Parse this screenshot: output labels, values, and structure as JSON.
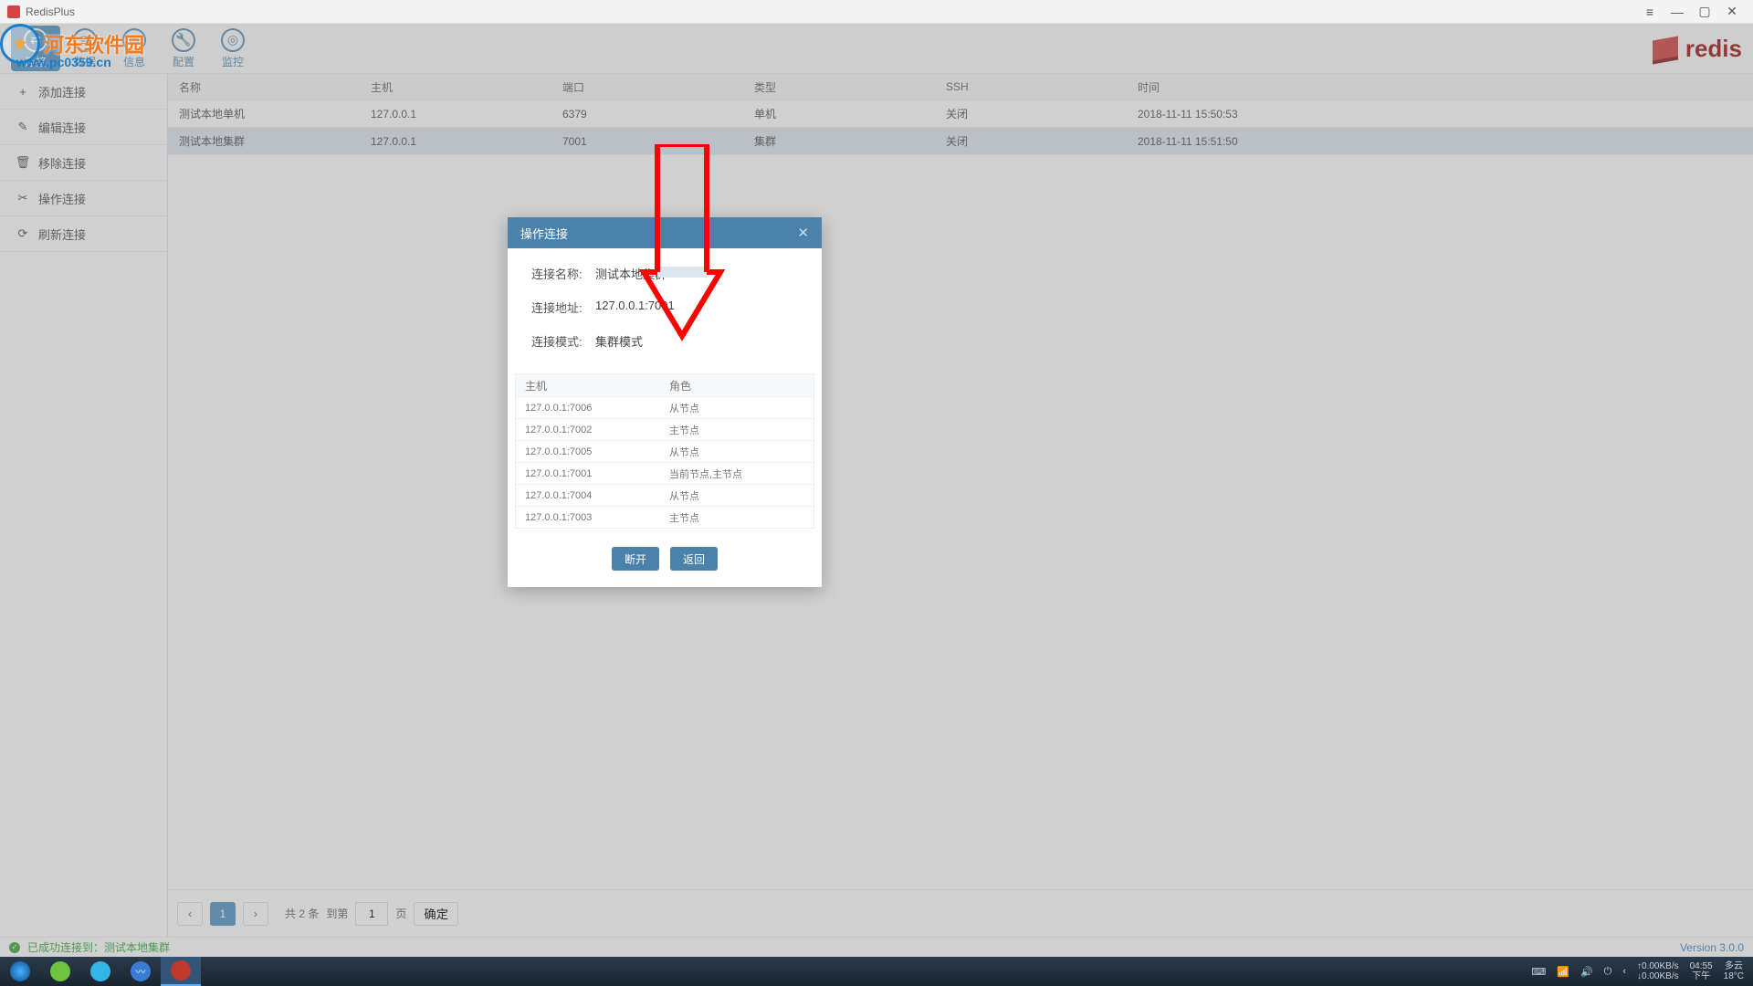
{
  "window": {
    "title": "RedisPlus"
  },
  "toolbar": {
    "items": [
      {
        "label": "连接"
      },
      {
        "label": "数据"
      },
      {
        "label": "信息"
      },
      {
        "label": "配置"
      },
      {
        "label": "监控"
      }
    ],
    "brand": "redis"
  },
  "sidebar": {
    "items": [
      {
        "label": "添加连接"
      },
      {
        "label": "编辑连接"
      },
      {
        "label": "移除连接"
      },
      {
        "label": "操作连接"
      },
      {
        "label": "刷新连接"
      }
    ]
  },
  "table": {
    "headers": {
      "name": "名称",
      "host": "主机",
      "port": "端口",
      "type": "类型",
      "ssh": "SSH",
      "time": "时间"
    },
    "rows": [
      {
        "name": "测试本地单机",
        "host": "127.0.0.1",
        "port": "6379",
        "type": "单机",
        "ssh": "关闭",
        "time": "2018-11-11 15:50:53"
      },
      {
        "name": "测试本地集群",
        "host": "127.0.0.1",
        "port": "7001",
        "type": "集群",
        "ssh": "关闭",
        "time": "2018-11-11 15:51:50"
      }
    ]
  },
  "pager": {
    "page": "1",
    "total_text": "共 2 条",
    "goto_text": "到第",
    "page_input": "1",
    "page_suffix": "页",
    "confirm": "确定"
  },
  "status": {
    "message": "已成功连接到：测试本地集群",
    "version": "Version 3.0.0"
  },
  "modal": {
    "title": "操作连接",
    "fields": {
      "name_label": "连接名称:",
      "name_value": "测试本地集群",
      "addr_label": "连接地址:",
      "addr_value": "127.0.0.1:7001",
      "mode_label": "连接模式:",
      "mode_value": "集群模式"
    },
    "table": {
      "head_host": "主机",
      "head_role": "角色",
      "rows": [
        {
          "host": "127.0.0.1:7006",
          "role": "从节点"
        },
        {
          "host": "127.0.0.1:7002",
          "role": "主节点"
        },
        {
          "host": "127.0.0.1:7005",
          "role": "从节点"
        },
        {
          "host": "127.0.0.1:7001",
          "role": "当前节点,主节点"
        },
        {
          "host": "127.0.0.1:7004",
          "role": "从节点"
        },
        {
          "host": "127.0.0.1:7003",
          "role": "主节点"
        }
      ]
    },
    "buttons": {
      "disconnect": "断开",
      "back": "返回"
    }
  },
  "watermark": {
    "text": "河东软件园",
    "url": "www.pc0359.cn"
  },
  "os": {
    "net_up": "↑0.00KB/s",
    "net_down": "↓0.00KB/s",
    "time": "04:55",
    "ampm": "下午",
    "weather_desc": "多云",
    "weather_temp": "18°C"
  }
}
